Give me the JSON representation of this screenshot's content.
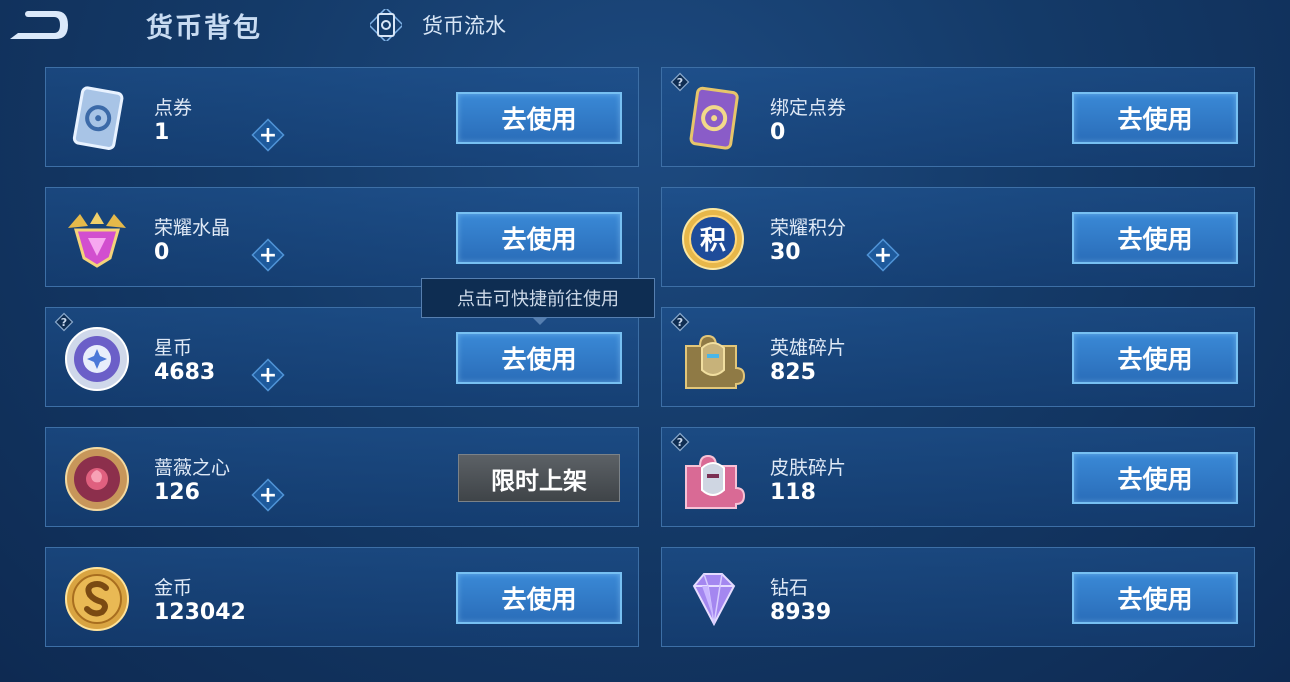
{
  "header": {
    "title": "货币背包",
    "history_label": "货币流水"
  },
  "tooltip": "点击可快捷前往使用",
  "currencies": [
    {
      "name": "点券",
      "amount": "1",
      "button": "去使用",
      "icon": "voucher-icon"
    },
    {
      "name": "绑定点券",
      "amount": "0",
      "button": "去使用",
      "icon": "bound-voucher-icon"
    },
    {
      "name": "荣耀水晶",
      "amount": "0",
      "button": "去使用",
      "icon": "glory-crystal-icon"
    },
    {
      "name": "荣耀积分",
      "amount": "30",
      "button": "去使用",
      "icon": "glory-points-icon"
    },
    {
      "name": "星币",
      "amount": "4683",
      "button": "去使用",
      "icon": "star-coin-icon"
    },
    {
      "name": "英雄碎片",
      "amount": "825",
      "button": "去使用",
      "icon": "hero-fragment-icon"
    },
    {
      "name": "蔷薇之心",
      "amount": "126",
      "button": "限时上架",
      "icon": "rose-heart-icon"
    },
    {
      "name": "皮肤碎片",
      "amount": "118",
      "button": "去使用",
      "icon": "skin-fragment-icon"
    },
    {
      "name": "金币",
      "amount": "123042",
      "button": "去使用",
      "icon": "gold-coin-icon"
    },
    {
      "name": "钻石",
      "amount": "8939",
      "button": "去使用",
      "icon": "diamond-icon"
    }
  ],
  "help_glyph": "?",
  "plus_glyph": "+",
  "special_glyph": "积",
  "colors": {
    "accent": "#2f7bd0",
    "button_border": "#77c0f2",
    "disabled": "#4c5156"
  }
}
